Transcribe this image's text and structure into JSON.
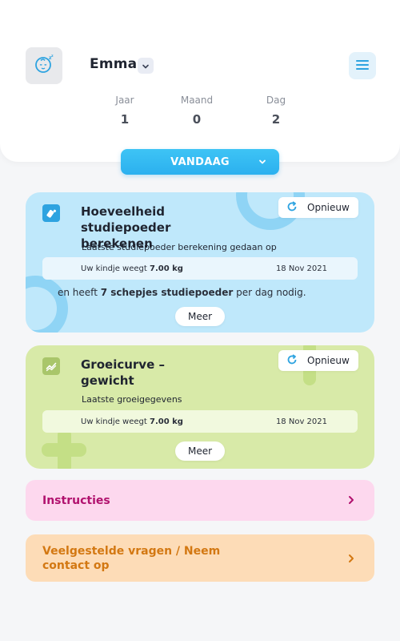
{
  "profile": {
    "name": "Emma"
  },
  "age": {
    "year_label": "Jaar",
    "year_value": "1",
    "month_label": "Maand",
    "month_value": "0",
    "day_label": "Dag",
    "day_value": "2"
  },
  "today_button": {
    "label": "VANDAAG"
  },
  "formula_card": {
    "title": "Hoeveelheid studiepoeder berekenen",
    "refresh_label": "Opnieuw",
    "subtitle": "Laatste studiepoeder berekening gedaan op",
    "weight_prefix": "Uw kindje weegt",
    "weight_value": "7.00 kg",
    "date": "18 Nov 2021",
    "result_prefix": "en heeft",
    "result_amount": "7 schepjes studiepoeder",
    "result_suffix": "per dag nodig.",
    "more_label": "Meer"
  },
  "growth_card": {
    "title": "Groeicurve – gewicht",
    "refresh_label": "Opnieuw",
    "subtitle": "Laatste groeigegevens",
    "weight_prefix": "Uw kindje weegt",
    "weight_value": "7.00 kg",
    "date": "18 Nov 2021",
    "more_label": "Meer"
  },
  "links": {
    "instructions": "Instructies",
    "faq_contact": "Veelgestelde vragen / Neem contact op"
  },
  "colors": {
    "accent_blue": "#2bb0ef",
    "formula_card_bg": "#bfe8fb",
    "growth_card_bg": "#d8eaa8",
    "instructions_bg": "#fdd8ee",
    "instructions_text": "#b1126e",
    "faq_bg": "#fddcb7",
    "faq_text": "#d37812"
  },
  "icons": {
    "avatar": "sleeping-baby-icon",
    "profile_dropdown": "chevron-down-icon",
    "menu": "hamburger-menu-icon",
    "formula_card": "bottle-icon",
    "growth_card": "growth-chart-icon",
    "refresh": "refresh-icon",
    "link_arrow": "chevron-right-icon"
  }
}
